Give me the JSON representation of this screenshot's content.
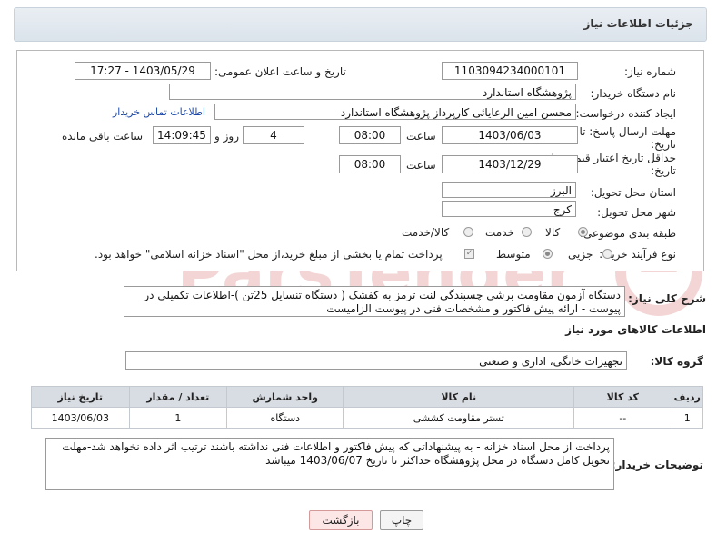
{
  "header": {
    "title": "جزئیات اطلاعات نیاز"
  },
  "fields": {
    "need_number_label": "شماره نیاز:",
    "need_number": "1103094234000101",
    "announce_label": "تاریخ و ساعت اعلان عمومی:",
    "announce_value": "1403/05/29 - 17:27",
    "buyer_org_label": "نام دستگاه خریدار:",
    "buyer_org": "پژوهشگاه استاندارد",
    "creator_label": "ایجاد کننده درخواست:",
    "creator": "محسن امین الرعایائی کارپرداز پژوهشگاه استاندارد",
    "contact_link": "اطلاعات تماس خریدار",
    "deadline_label_1": "مهلت ارسال پاسخ: تا",
    "deadline_label_2": "تاریخ:",
    "deadline_date": "1403/06/03",
    "time_label": "ساعت",
    "deadline_time": "08:00",
    "days_value": "4",
    "days_label": "روز و",
    "remaining_time": "14:09:45",
    "remaining_label": "ساعت باقی مانده",
    "validity_label_1": "حداقل تاریخ اعتبار قیمت: تا",
    "validity_label_2": "تاریخ:",
    "validity_date": "1403/12/29",
    "validity_time": "08:00",
    "province_label": "استان محل تحویل:",
    "province": "البرز",
    "city_label": "شهر محل تحویل:",
    "city": "کرج",
    "category_label": "طبقه بندی موضوعی:",
    "category_options": [
      "کالا",
      "خدمت",
      "کالا/خدمت"
    ],
    "process_label": "نوع فرآیند خرید :",
    "process_options": [
      "جزیی",
      "متوسط"
    ],
    "payment_note": "پرداخت تمام یا بخشی از مبلغ خرید،از محل \"اسناد خزانه اسلامی\" خواهد بود."
  },
  "summary": {
    "label": "شرح کلی نیاز:",
    "text": "دستگاه آزمون مقاومت برشی چسبندگی لنت ترمز به کفشک ( دستگاه تنسایل 25تن )-اطلاعات تکمیلی در پیوست - ارائه پیش فاکتور و مشخصات فنی در پیوست الزامیست"
  },
  "goods": {
    "section_title": "اطلاعات کالاهای مورد نیاز",
    "group_label": "گروه کالا:",
    "group_value": "تجهیزات خانگی، اداری و صنعتی",
    "columns": [
      "ردیف",
      "کد کالا",
      "نام کالا",
      "واحد شمارش",
      "تعداد / مقدار",
      "تاریخ نیاز"
    ],
    "rows": [
      [
        "1",
        "--",
        "تستر مقاومت کششی",
        "دستگاه",
        "1",
        "1403/06/03"
      ]
    ]
  },
  "buyer_notes": {
    "label": "توضیحات خریدار:",
    "text": "پرداخت از محل اسناد خزانه - به پیشنهاداتی که پیش فاکتور و اطلاعات فنی نداشته باشند ترتیب اثر داده نخواهد شد-مهلت تحویل کامل دستگاه در محل پژوهشگاه حداکثر تا تاریخ  1403/06/07  میباشد"
  },
  "buttons": {
    "print": "چاپ",
    "back": "بازگشت"
  },
  "colors": {
    "header_bg": "#dbe3eb",
    "link": "#1a47a8",
    "table_header": "#d8dde3",
    "back_button": "#fde6e6"
  }
}
